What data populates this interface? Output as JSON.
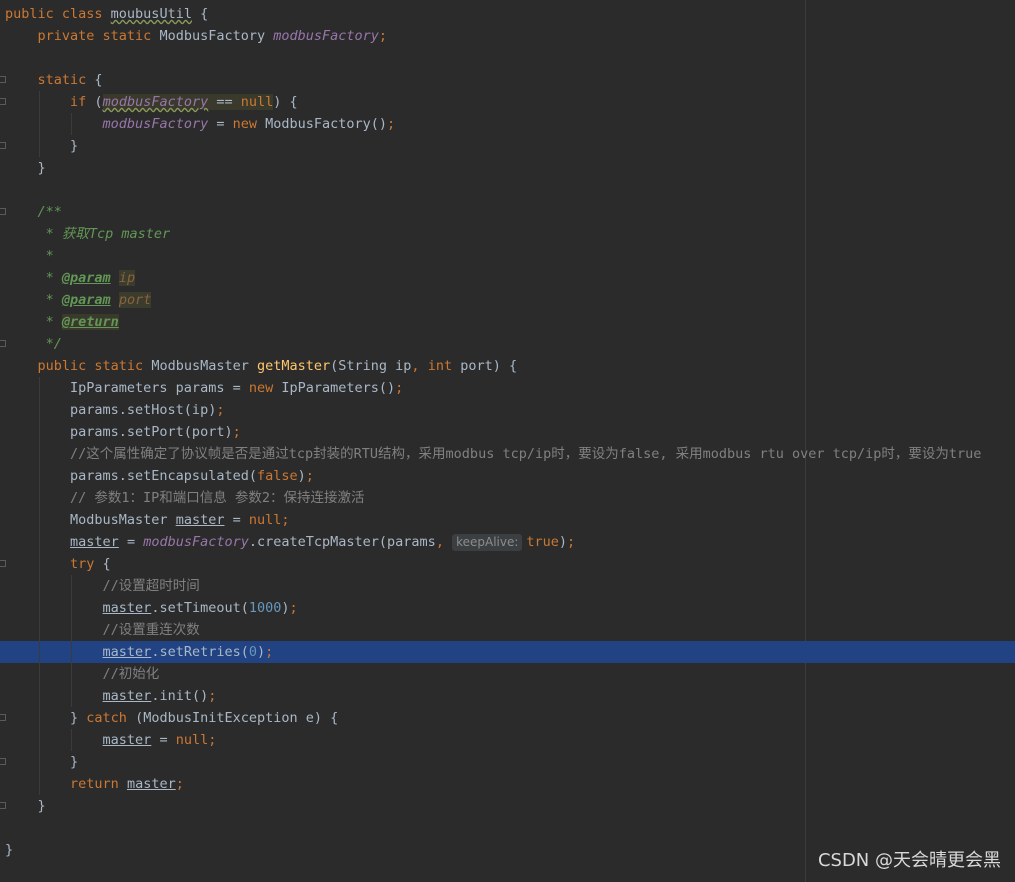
{
  "editor": {
    "lines": [
      [
        {
          "t": "public class ",
          "c": "kw"
        },
        {
          "t": "moubusUtil",
          "c": "wave"
        },
        {
          "t": " {"
        }
      ],
      [
        {
          "t": "    "
        },
        {
          "t": "private static ",
          "c": "kw"
        },
        {
          "t": "ModbusFactory "
        },
        {
          "t": "modbusFactory",
          "c": "fld"
        },
        {
          "t": ";",
          "c": "kw"
        }
      ],
      [],
      [
        {
          "t": "    "
        },
        {
          "t": "static ",
          "c": "kw"
        },
        {
          "t": "{"
        }
      ],
      [
        {
          "t": "        "
        },
        {
          "t": "if ",
          "c": "kw"
        },
        {
          "t": "("
        },
        {
          "t": "modbusFactory",
          "c": "fld hl wave"
        },
        {
          "t": " == ",
          "c": "hl"
        },
        {
          "t": "null",
          "c": "kw hl"
        },
        {
          "t": ") {"
        }
      ],
      [
        {
          "t": "            "
        },
        {
          "t": "modbusFactory",
          "c": "fld"
        },
        {
          "t": " = "
        },
        {
          "t": "new ",
          "c": "kw"
        },
        {
          "t": "ModbusFactory()"
        },
        {
          "t": ";",
          "c": "kw"
        }
      ],
      [
        {
          "t": "        }"
        }
      ],
      [
        {
          "t": "    }"
        }
      ],
      [],
      [
        {
          "t": "    "
        },
        {
          "t": "/**",
          "c": "doc"
        }
      ],
      [
        {
          "t": "     "
        },
        {
          "t": "* 获取Tcp master",
          "c": "doc"
        }
      ],
      [
        {
          "t": "     "
        },
        {
          "t": "*",
          "c": "doc"
        }
      ],
      [
        {
          "t": "     "
        },
        {
          "t": "* ",
          "c": "doc"
        },
        {
          "t": "@param",
          "c": "tag"
        },
        {
          "t": " "
        },
        {
          "t": "ip",
          "c": "dochl"
        }
      ],
      [
        {
          "t": "     "
        },
        {
          "t": "* ",
          "c": "doc"
        },
        {
          "t": "@param",
          "c": "tag"
        },
        {
          "t": " "
        },
        {
          "t": "port",
          "c": "dochl"
        }
      ],
      [
        {
          "t": "     "
        },
        {
          "t": "* ",
          "c": "doc"
        },
        {
          "t": "@return",
          "c": "tag hl"
        }
      ],
      [
        {
          "t": "     "
        },
        {
          "t": "*/",
          "c": "doc"
        }
      ],
      [
        {
          "t": "    "
        },
        {
          "t": "public static ",
          "c": "kw"
        },
        {
          "t": "ModbusMaster "
        },
        {
          "t": "getMaster",
          "c": "fn"
        },
        {
          "t": "(String ip"
        },
        {
          "t": ", ",
          "c": "kw"
        },
        {
          "t": "int ",
          "c": "kw"
        },
        {
          "t": "port) {"
        }
      ],
      [
        {
          "t": "        IpParameters params = "
        },
        {
          "t": "new ",
          "c": "kw"
        },
        {
          "t": "IpParameters()"
        },
        {
          "t": ";",
          "c": "kw"
        }
      ],
      [
        {
          "t": "        params.setHost(ip)"
        },
        {
          "t": ";",
          "c": "kw"
        }
      ],
      [
        {
          "t": "        params.setPort(port)"
        },
        {
          "t": ";",
          "c": "kw"
        }
      ],
      [
        {
          "t": "        "
        },
        {
          "t": "//这个属性确定了协议帧是否是通过tcp封装的RTU结构，采用modbus tcp/ip时，要设为false, 采用modbus rtu over tcp/ip时，要设为true",
          "c": "cmt"
        }
      ],
      [
        {
          "t": "        params.setEncapsulated("
        },
        {
          "t": "false",
          "c": "kw"
        },
        {
          "t": ")"
        },
        {
          "t": ";",
          "c": "kw"
        }
      ],
      [
        {
          "t": "        "
        },
        {
          "t": "// 参数1：IP和端口信息 参数2：保持连接激活",
          "c": "cmt"
        }
      ],
      [
        {
          "t": "        ModbusMaster "
        },
        {
          "t": "master",
          "c": "und"
        },
        {
          "t": " = "
        },
        {
          "t": "null",
          "c": "kw"
        },
        {
          "t": ";",
          "c": "kw"
        }
      ],
      [
        {
          "t": "        "
        },
        {
          "t": "master",
          "c": "und"
        },
        {
          "t": " = "
        },
        {
          "t": "modbusFactory",
          "c": "fld"
        },
        {
          "t": ".createTcpMaster(params"
        },
        {
          "t": ", ",
          "c": "kw"
        },
        {
          "t": "keepAlive:",
          "c": "hint"
        },
        {
          "t": "true",
          "c": "kw"
        },
        {
          "t": ")"
        },
        {
          "t": ";",
          "c": "kw"
        }
      ],
      [
        {
          "t": "        "
        },
        {
          "t": "try ",
          "c": "kw"
        },
        {
          "t": "{"
        }
      ],
      [
        {
          "t": "            "
        },
        {
          "t": "//设置超时时间",
          "c": "cmt"
        }
      ],
      [
        {
          "t": "            "
        },
        {
          "t": "master",
          "c": "und"
        },
        {
          "t": ".setTimeout("
        },
        {
          "t": "1000",
          "c": "num"
        },
        {
          "t": ")"
        },
        {
          "t": ";",
          "c": "kw"
        }
      ],
      [
        {
          "t": "            "
        },
        {
          "t": "//设置重连次数",
          "c": "cmt"
        }
      ],
      [
        {
          "t": "            "
        },
        {
          "t": "master",
          "c": "und"
        },
        {
          "t": ".setRetries("
        },
        {
          "t": "0",
          "c": "num"
        },
        {
          "t": ")"
        },
        {
          "t": ";",
          "c": "kw"
        }
      ],
      [
        {
          "t": "            "
        },
        {
          "t": "//初始化",
          "c": "cmt"
        }
      ],
      [
        {
          "t": "            "
        },
        {
          "t": "master",
          "c": "und"
        },
        {
          "t": ".init()"
        },
        {
          "t": ";",
          "c": "kw"
        }
      ],
      [
        {
          "t": "        } "
        },
        {
          "t": "catch ",
          "c": "kw"
        },
        {
          "t": "(ModbusInitException e) {"
        }
      ],
      [
        {
          "t": "            "
        },
        {
          "t": "master",
          "c": "und"
        },
        {
          "t": " = "
        },
        {
          "t": "null",
          "c": "kw"
        },
        {
          "t": ";",
          "c": "kw"
        }
      ],
      [
        {
          "t": "        }"
        }
      ],
      [
        {
          "t": "        "
        },
        {
          "t": "return ",
          "c": "kw"
        },
        {
          "t": "master",
          "c": "und"
        },
        {
          "t": ";",
          "c": "kw"
        }
      ],
      [
        {
          "t": "    }"
        }
      ],
      [],
      [
        {
          "t": "}"
        }
      ]
    ],
    "selected_line": 29,
    "fold_markers": [
      3,
      4,
      6,
      9,
      15,
      25,
      32,
      34,
      36
    ],
    "indent_guides": [
      {
        "line": 4,
        "cols": [
          4
        ]
      },
      {
        "line": 5,
        "cols": [
          4,
          8
        ]
      },
      {
        "line": 6,
        "cols": [
          4
        ]
      },
      {
        "line": 17,
        "cols": [
          4
        ]
      },
      {
        "line": 18,
        "cols": [
          4
        ]
      },
      {
        "line": 19,
        "cols": [
          4
        ]
      },
      {
        "line": 20,
        "cols": [
          4
        ]
      },
      {
        "line": 21,
        "cols": [
          4
        ]
      },
      {
        "line": 22,
        "cols": [
          4
        ]
      },
      {
        "line": 23,
        "cols": [
          4
        ]
      },
      {
        "line": 24,
        "cols": [
          4
        ]
      },
      {
        "line": 25,
        "cols": [
          4
        ]
      },
      {
        "line": 26,
        "cols": [
          4,
          8
        ]
      },
      {
        "line": 27,
        "cols": [
          4,
          8
        ]
      },
      {
        "line": 28,
        "cols": [
          4,
          8
        ]
      },
      {
        "line": 29,
        "cols": [
          4,
          8
        ]
      },
      {
        "line": 30,
        "cols": [
          4,
          8
        ]
      },
      {
        "line": 31,
        "cols": [
          4,
          8
        ]
      },
      {
        "line": 32,
        "cols": [
          4
        ]
      },
      {
        "line": 33,
        "cols": [
          4,
          8
        ]
      },
      {
        "line": 34,
        "cols": [
          4
        ]
      },
      {
        "line": 35,
        "cols": [
          4
        ]
      }
    ]
  },
  "watermark": "CSDN @天会晴更会黑"
}
